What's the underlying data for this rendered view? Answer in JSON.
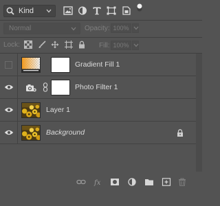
{
  "filter": {
    "kind_label": "Kind",
    "icons": [
      "image-filter-icon",
      "adjustment-filter-icon",
      "type-filter-icon",
      "shape-filter-icon",
      "smart-object-filter-icon",
      "filter-toggle-icon"
    ]
  },
  "blend": {
    "mode": "Normal",
    "opacity_label": "Opacity:",
    "opacity_value": "100%",
    "fill_label": "Fill:",
    "fill_value": "100%"
  },
  "lock": {
    "label": "Lock:",
    "icons": [
      "lock-transparent-pixels-icon",
      "lock-image-pixels-icon",
      "lock-position-icon",
      "lock-artboard-icon",
      "lock-all-icon"
    ]
  },
  "layers": [
    {
      "name": "Gradient Fill 1",
      "visible": false,
      "italic": false
    },
    {
      "name": "Photo Filter 1",
      "visible": true,
      "italic": false
    },
    {
      "name": "Layer 1",
      "visible": true,
      "italic": false
    },
    {
      "name": "Background",
      "visible": true,
      "italic": true,
      "locked": true
    }
  ],
  "bottom_icons": [
    "link-layers-icon",
    "fx-icon",
    "add-mask-icon",
    "new-adjustment-icon",
    "new-group-icon",
    "new-layer-icon",
    "delete-layer-icon"
  ],
  "colors": {
    "panel_bg": "#535353",
    "text": "#dcdcdc",
    "dim_text": "#7a7a7a"
  }
}
